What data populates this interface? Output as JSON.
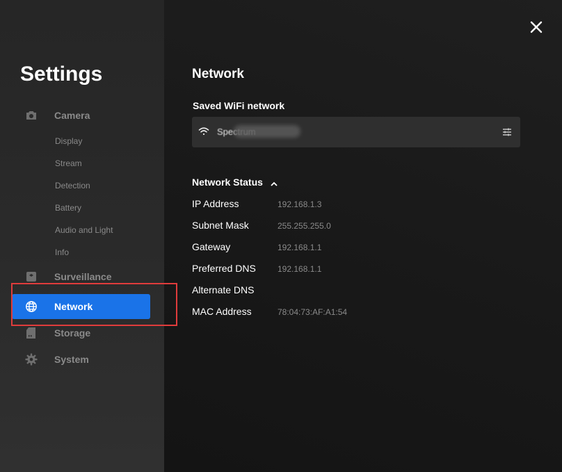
{
  "app": {
    "title": "Settings",
    "close_icon": "close-icon"
  },
  "sidebar": {
    "camera": {
      "label": "Camera",
      "icon": "camera-icon",
      "items": [
        "Display",
        "Stream",
        "Detection",
        "Battery",
        "Audio and Light",
        "Info"
      ]
    },
    "surveillance": {
      "label": "Surveillance",
      "icon": "surveillance-icon"
    },
    "network": {
      "label": "Network",
      "icon": "globe-icon",
      "active": true
    },
    "storage": {
      "label": "Storage",
      "icon": "sd-card-icon"
    },
    "system": {
      "label": "System",
      "icon": "gear-icon"
    }
  },
  "main": {
    "section_title": "Network",
    "saved_wifi": {
      "heading": "Saved WiFi network",
      "ssid": "Spectrum",
      "wifi_icon": "wifi-icon",
      "settings_icon": "sliders-icon"
    },
    "status": {
      "heading": "Network Status",
      "toggle_icon": "chevron-up-icon",
      "rows": [
        {
          "key": "IP Address",
          "value": "192.168.1.3"
        },
        {
          "key": "Subnet Mask",
          "value": "255.255.255.0"
        },
        {
          "key": "Gateway",
          "value": "192.168.1.1"
        },
        {
          "key": "Preferred DNS",
          "value": "192.168.1.1"
        },
        {
          "key": "Alternate DNS",
          "value": ""
        },
        {
          "key": "MAC Address",
          "value": "78:04:73:AF:A1:54"
        }
      ]
    }
  },
  "colors": {
    "accent": "#1a73e8",
    "highlight": "#e03c3c",
    "sidebar_bg": "#2a2a2a",
    "main_bg": "#1a1a1a"
  }
}
